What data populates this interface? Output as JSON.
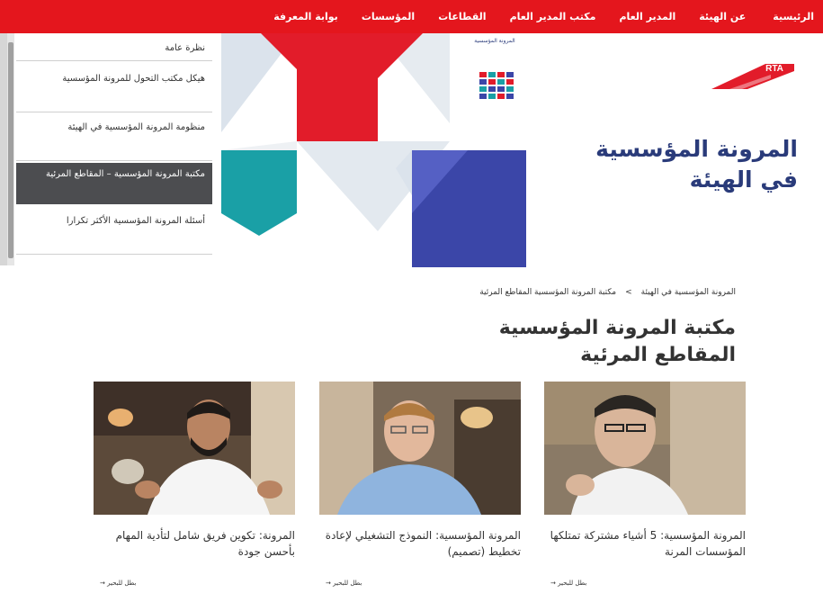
{
  "nav": {
    "items": [
      "الرئيسية",
      "عن الهيئة",
      "المدير العام",
      "مكتب المدير العام",
      "القطاعات",
      "المؤسسات",
      "بوابة المعرفة"
    ]
  },
  "hero": {
    "title": "المرونة المؤسسية في الهيئة",
    "logo_text": "RTA",
    "badge_text": "المرونة المؤسسية"
  },
  "sidemenu": {
    "items": [
      {
        "label": "نظرة عامة",
        "active": false
      },
      {
        "label": "هيكل مكتب التحول للمرونة المؤسسية",
        "active": false
      },
      {
        "label": "منظومة المرونة المؤسسية في الهيئة",
        "active": false
      },
      {
        "label": "مكتبة المرونة المؤسسية – المقاطع المرئية",
        "active": true
      },
      {
        "label": "أسئلة المرونة المؤسسية الأكثر تكرارا",
        "active": false
      }
    ]
  },
  "breadcrumb": {
    "items": [
      "المرونة المؤسسية في الهيئة",
      ">",
      "مكتبة المرونة المؤسسية المقاطع المرئية"
    ]
  },
  "page": {
    "title": "مكتبة المرونة المؤسسية المقاطع المرئية"
  },
  "cards": [
    {
      "title": "المرونة المؤسسية: 5 أشياء مشتركة تمتلكها المؤسسات المرنة",
      "link": "بطل للبحير →"
    },
    {
      "title": "المرونة المؤسسية: النموذج التشغيلي لإعادة تخطيط (تصميم)",
      "link": "بطل للبحير →"
    },
    {
      "title": "المرونة: تكوين فريق شامل لتأدية المهام بأحسن جودة",
      "link": "بطل للبحير →"
    }
  ],
  "colors": {
    "nav_red": "#e4161d",
    "brand_blue": "#2a3b7a",
    "hero_red": "#e21c2a",
    "hero_teal": "#1aa0a6",
    "hero_blue": "#3b46a8",
    "menu_active": "#4c4d50"
  }
}
